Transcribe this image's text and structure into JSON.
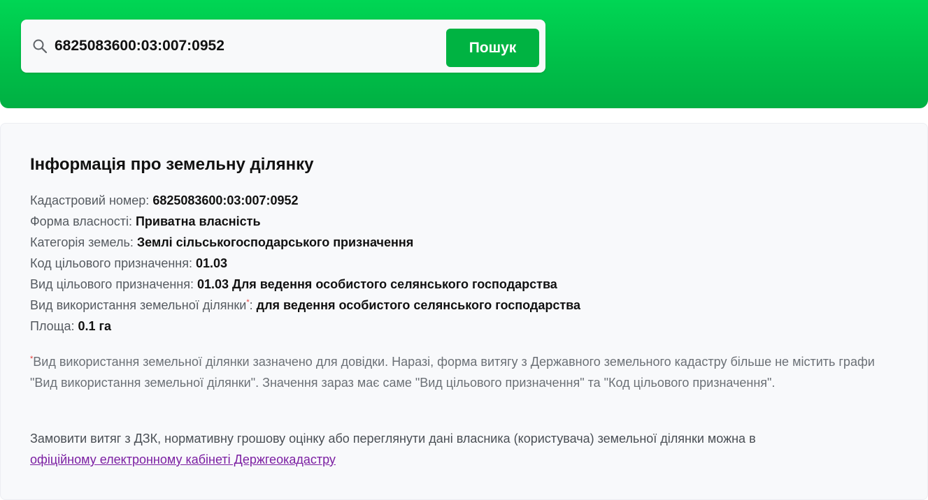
{
  "search": {
    "value": "6825083600:03:007:0952",
    "button_label": "Пошук",
    "icon": "search-icon"
  },
  "info": {
    "title": "Інформація про земельну ділянку",
    "rows": [
      {
        "label": "Кадастровий номер:",
        "value": "6825083600:03:007:0952"
      },
      {
        "label": "Форма власності:",
        "value": "Приватна власність"
      },
      {
        "label": "Категорія земель:",
        "value": "Землі сільськогосподарського призначення"
      },
      {
        "label": "Код цільового призначення:",
        "value": "01.03"
      },
      {
        "label": "Вид цільового призначення:",
        "value": "01.03 Для ведення особистого селянського господарства"
      },
      {
        "label": "Вид використання земельної ділянки",
        "asterisk": "*",
        "colon": ":",
        "value": "для ведення особистого селянського господарства"
      },
      {
        "label": "Площа:",
        "value": "0.1 га"
      }
    ],
    "footnote_asterisk": "*",
    "footnote": "Вид використання земельної ділянки зазначено для довідки. Наразі, форма витягу з Державного земельного кадастру більше не містить графи \"Вид використання земельної ділянки\". Значення зараз має саме \"Вид цільового призначення\" та \"Код цільового призначення\".",
    "order_text": "Замовити витяг з ДЗК, нормативну грошову оцінку або переглянути дані власника (користувача) земельної ділянки можна в",
    "link_text": "офіційному електронному кабінеті Держгеокадастру"
  },
  "colors": {
    "header_green": "#00c94e",
    "button_green": "#00b342",
    "link_purple": "#7b1fa2",
    "asterisk_red": "#e53935"
  }
}
